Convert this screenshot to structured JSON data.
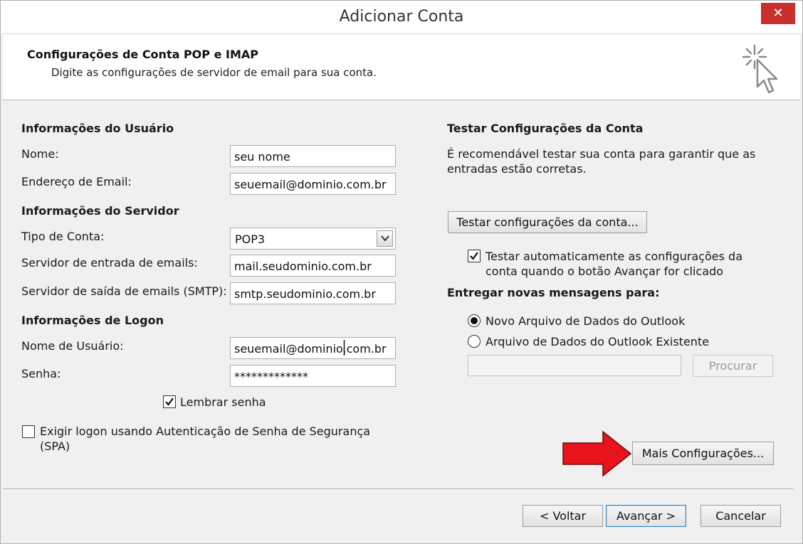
{
  "window": {
    "title": "Adicionar Conta",
    "close_label": "✕"
  },
  "header": {
    "title": "Configurações de Conta POP e IMAP",
    "subtitle": "Digite as configurações de servidor de email para sua conta."
  },
  "user_info": {
    "section_title": "Informações do Usuário",
    "name_label": "Nome:",
    "name_value": "seu nome",
    "email_label": "Endereço de Email:",
    "email_value": "seuemail@dominio.com.br"
  },
  "server_info": {
    "section_title": "Informações do Servidor",
    "account_type_label": "Tipo de Conta:",
    "account_type_value": "POP3",
    "incoming_label": "Servidor de entrada de emails:",
    "incoming_value": "mail.seudominio.com.br",
    "outgoing_label": "Servidor de saída de emails (SMTP):",
    "outgoing_value": "smtp.seudominio.com.br"
  },
  "logon_info": {
    "section_title": "Informações de Logon",
    "username_label": "Nome de Usuário:",
    "username_value": "seuemail@dominio.com.br",
    "password_label": "Senha:",
    "password_value": "*************",
    "remember_label": "Lembrar senha",
    "remember_checked": true,
    "spa_label_line1": "Exigir logon usando Autenticação de Senha de Segurança",
    "spa_label_line2": "(SPA)",
    "spa_checked": false
  },
  "test": {
    "section_title": "Testar Configurações da Conta",
    "description_line1": "É recomendável testar sua conta para garantir que as",
    "description_line2": "entradas estão corretas.",
    "test_button": "Testar configurações da conta...",
    "auto_test_line1": "Testar automaticamente as configurações da",
    "auto_test_line2": "conta quando o botão Avançar for clicado",
    "auto_test_checked": true
  },
  "deliver": {
    "section_title": "Entregar novas mensagens para:",
    "option_new": "Novo Arquivo de Dados do Outlook",
    "option_existing": "Arquivo de Dados do Outlook Existente",
    "selected": "new",
    "browse_button": "Procurar",
    "file_path": ""
  },
  "more_settings_button": "Mais Configurações...",
  "footer": {
    "back": "< Voltar",
    "next": "Avançar >",
    "cancel": "Cancelar"
  },
  "colors": {
    "annotation_arrow": "#e8141b",
    "close_button": "#c7302c"
  },
  "icons": {
    "header": "click-cursor-icon",
    "annotation": "red-arrow-icon"
  }
}
